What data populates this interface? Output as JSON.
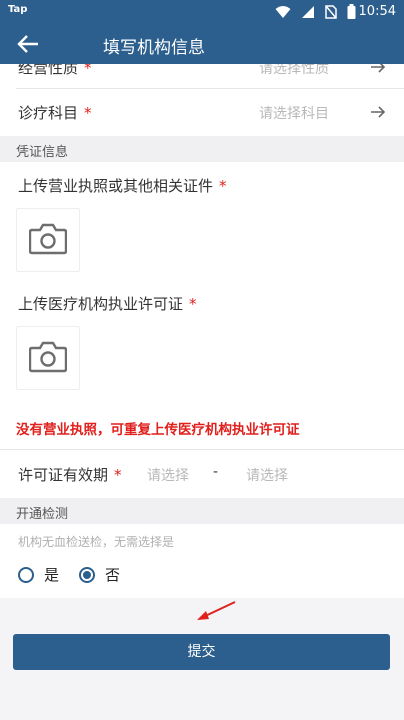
{
  "status_bar": {
    "app_label": "Tap",
    "time": "10:54"
  },
  "header": {
    "title": "填写机构信息"
  },
  "rows": {
    "business_nature": {
      "label": "经营性质",
      "placeholder": "请选择性质"
    },
    "departments": {
      "label": "诊疗科目",
      "placeholder": "请选择科目"
    }
  },
  "sections": {
    "credentials": "凭证信息",
    "activation": "开通检测"
  },
  "uploads": {
    "license": "上传营业执照或其他相关证件",
    "medical": "上传医疗机构执业许可证"
  },
  "warning": "没有营业执照，可重复上传医疗机构执业许可证",
  "validity": {
    "label": "许可证有效期",
    "start_placeholder": "请选择",
    "dash": "-",
    "end_placeholder": "请选择"
  },
  "activation": {
    "hint": "机构无血检送检，无需选择是",
    "options": [
      {
        "label": "是",
        "checked": false
      },
      {
        "label": "否",
        "checked": true
      }
    ]
  },
  "submit_label": "提交",
  "required_mark": "*",
  "colors": {
    "primary": "#2c5f8d",
    "required": "#e0201c",
    "annotation": "#e0201c"
  }
}
